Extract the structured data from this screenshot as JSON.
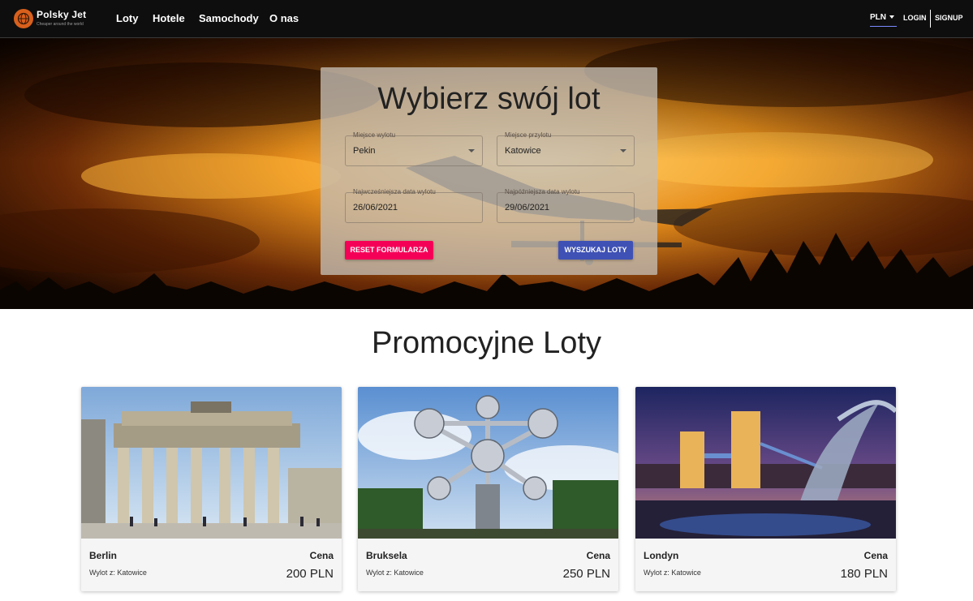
{
  "brand": {
    "name": "Polsky Jet",
    "tagline": "Cheaper around the world"
  },
  "nav": {
    "links": [
      "Loty",
      "Hotele",
      "Samochody",
      "O nas"
    ]
  },
  "topbar": {
    "currency": "PLN",
    "login": "LOGIN",
    "signup": "SIGNUP"
  },
  "search": {
    "title": "Wybierz swój lot",
    "from": {
      "label": "Miejsce wylotu",
      "value": "Pekin"
    },
    "to": {
      "label": "Miejsce przylotu",
      "value": "Katowice"
    },
    "date_from": {
      "label": "Najwcześniejsza data wylotu",
      "value": "26/06/2021"
    },
    "date_to": {
      "label": "Najpóźniejsza data wylotu",
      "value": "29/06/2021"
    },
    "reset_label": "RESET FORMULARZA",
    "search_label": "WYSZUKAJ LOTY"
  },
  "promo": {
    "title": "Promocyjne Loty",
    "cards": [
      {
        "city": "Berlin",
        "price_label": "Cena",
        "origin": "Wylot z: Katowice",
        "price": "200 PLN"
      },
      {
        "city": "Bruksela",
        "price_label": "Cena",
        "origin": "Wylot z: Katowice",
        "price": "250 PLN"
      },
      {
        "city": "Londyn",
        "price_label": "Cena",
        "origin": "Wylot z: Katowice",
        "price": "180 PLN"
      }
    ]
  },
  "colors": {
    "reset_button": "#f50057",
    "search_button": "#3f51b5",
    "nav_bg": "#0e0e0e",
    "logo": "#d8601c"
  }
}
